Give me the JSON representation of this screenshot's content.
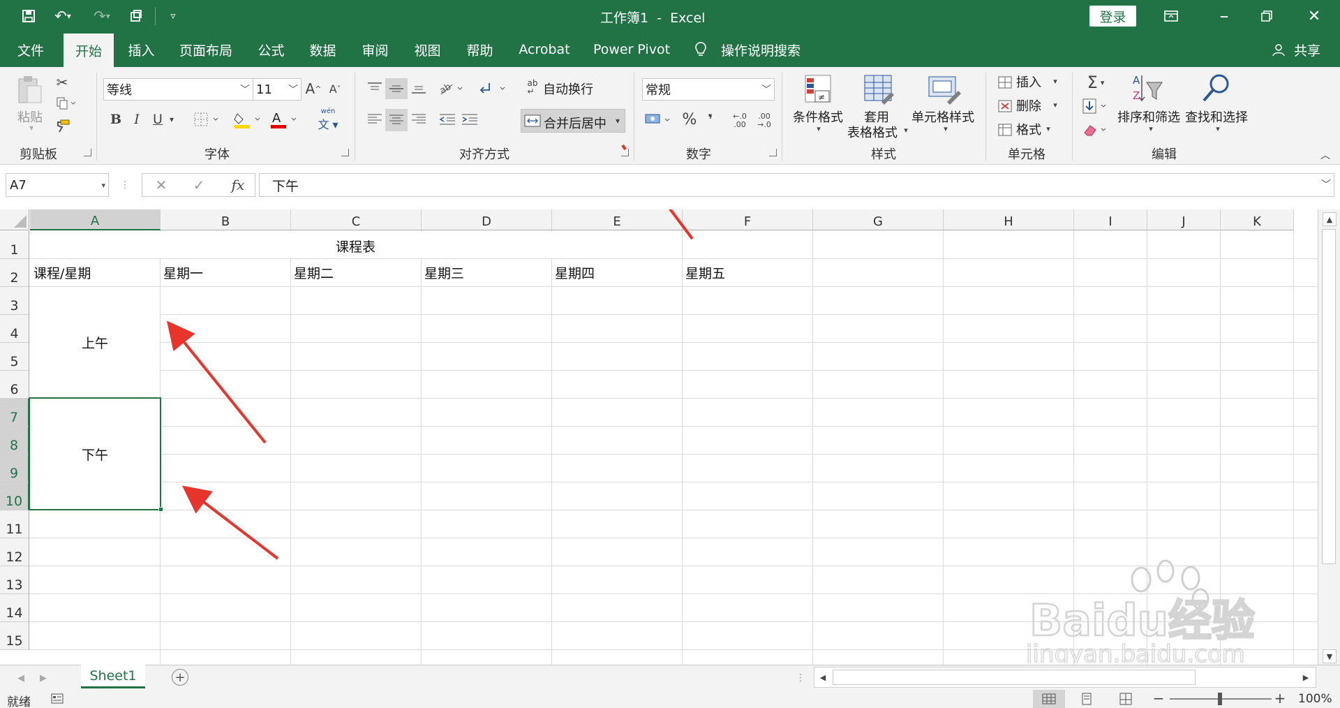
{
  "window": {
    "title": "工作簿1  -  Excel",
    "login": "登录"
  },
  "menu": {
    "tabs": [
      "文件",
      "开始",
      "插入",
      "页面布局",
      "公式",
      "数据",
      "审阅",
      "视图",
      "帮助",
      "Acrobat",
      "Power Pivot"
    ],
    "tellme": "操作说明搜索",
    "share": "共享"
  },
  "ribbon": {
    "clipboard": {
      "paste": "粘贴",
      "group": "剪贴板"
    },
    "font": {
      "name": "等线",
      "size": "11",
      "phonetic": "wén",
      "bold": "B",
      "italic": "I",
      "underline": "U",
      "grow": "A",
      "shrink": "A",
      "group": "字体"
    },
    "alignment": {
      "wrap": "自动换行",
      "merge": "合并后居中",
      "group": "对齐方式"
    },
    "number": {
      "format": "常规",
      "percent": "%",
      "comma": "❜",
      "inc": "←.0\n.00",
      "dec": ".00\n→.0",
      "group": "数字"
    },
    "styles": {
      "conditional": "条件格式",
      "table_l1": "套用",
      "table_l2": "表格格式",
      "cell_styles": "单元格样式",
      "group": "样式"
    },
    "cells": {
      "insert": "插入",
      "delete": "删除",
      "format": "格式",
      "group": "单元格"
    },
    "editing": {
      "sort": "排序和筛选",
      "find": "查找和选择",
      "group": "编辑"
    }
  },
  "formula": {
    "namebox": "A7",
    "content": "下午"
  },
  "columns": [
    "A",
    "B",
    "C",
    "D",
    "E",
    "F",
    "G",
    "H",
    "I",
    "J",
    "K"
  ],
  "rows": [
    "1",
    "2",
    "3",
    "4",
    "5",
    "6",
    "7",
    "8",
    "9",
    "10",
    "11",
    "12",
    "13",
    "14",
    "15"
  ],
  "cells": {
    "title": "课程表",
    "header": [
      "课程/星期",
      "星期一",
      "星期二",
      "星期三",
      "星期四",
      "星期五"
    ],
    "morning": "上午",
    "afternoon": "下午"
  },
  "sheet": {
    "tab": "Sheet1"
  },
  "status": {
    "ready": "就绪",
    "zoom": "100%"
  },
  "watermark": {
    "line1": "Baidu经验",
    "line2": "jingyan.baidu.com"
  },
  "colors": {
    "excel_green": "#217346",
    "arrow_red": "#e8352c"
  }
}
